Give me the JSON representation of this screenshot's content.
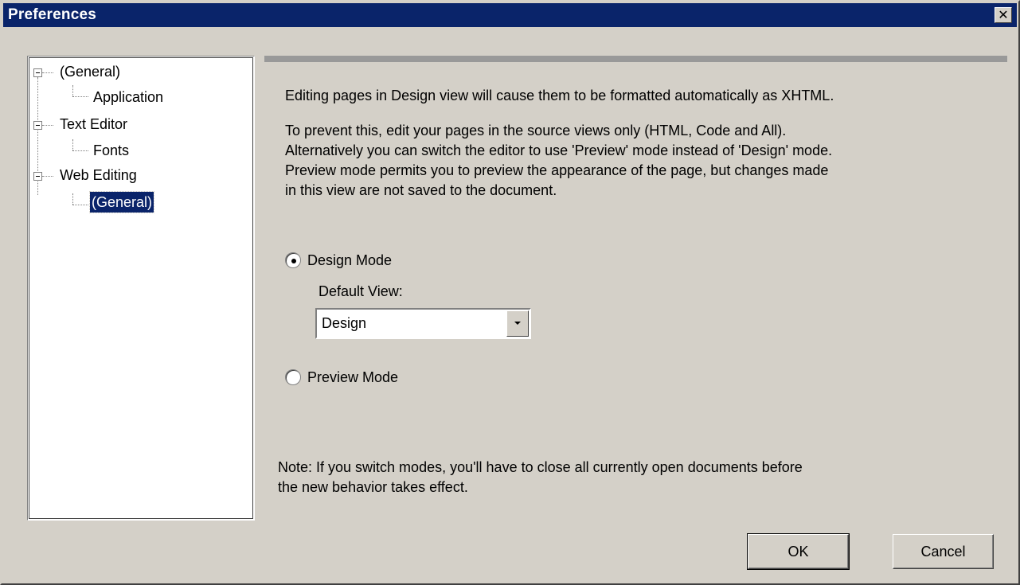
{
  "window": {
    "title": "Preferences",
    "close_glyph": "✕"
  },
  "tree": {
    "items": [
      {
        "label": "(General)",
        "level": 0,
        "expanded": true
      },
      {
        "label": "Application",
        "level": 1
      },
      {
        "label": "Text Editor",
        "level": 0,
        "expanded": true
      },
      {
        "label": "Fonts",
        "level": 1
      },
      {
        "label": "Web Editing",
        "level": 0,
        "expanded": true
      },
      {
        "label": "(General)",
        "level": 1,
        "selected": true
      }
    ]
  },
  "content": {
    "intro": "Editing pages in Design view will cause them to be formatted automatically as XHTML.",
    "detail_lines": [
      "To prevent this, edit your pages in the source views only (HTML, Code and All).",
      "Alternatively you can switch the editor to use 'Preview' mode instead of 'Design' mode.",
      "Preview mode permits you to preview the appearance of the page, but changes made",
      "in this view are not saved to the document."
    ],
    "design_mode_label": "Design Mode",
    "default_view_label": "Default View:",
    "default_view_value": "Design",
    "preview_mode_label": "Preview Mode",
    "note_lines": [
      "Note: If you switch modes, you'll have to close all currently open documents before",
      "the new behavior takes effect."
    ]
  },
  "buttons": {
    "ok": "OK",
    "cancel": "Cancel"
  },
  "state": {
    "selected_mode": "design"
  },
  "colors": {
    "titlebar": "#0a246a",
    "dialog": "#d4d0c8",
    "selection": "#0a246a"
  }
}
